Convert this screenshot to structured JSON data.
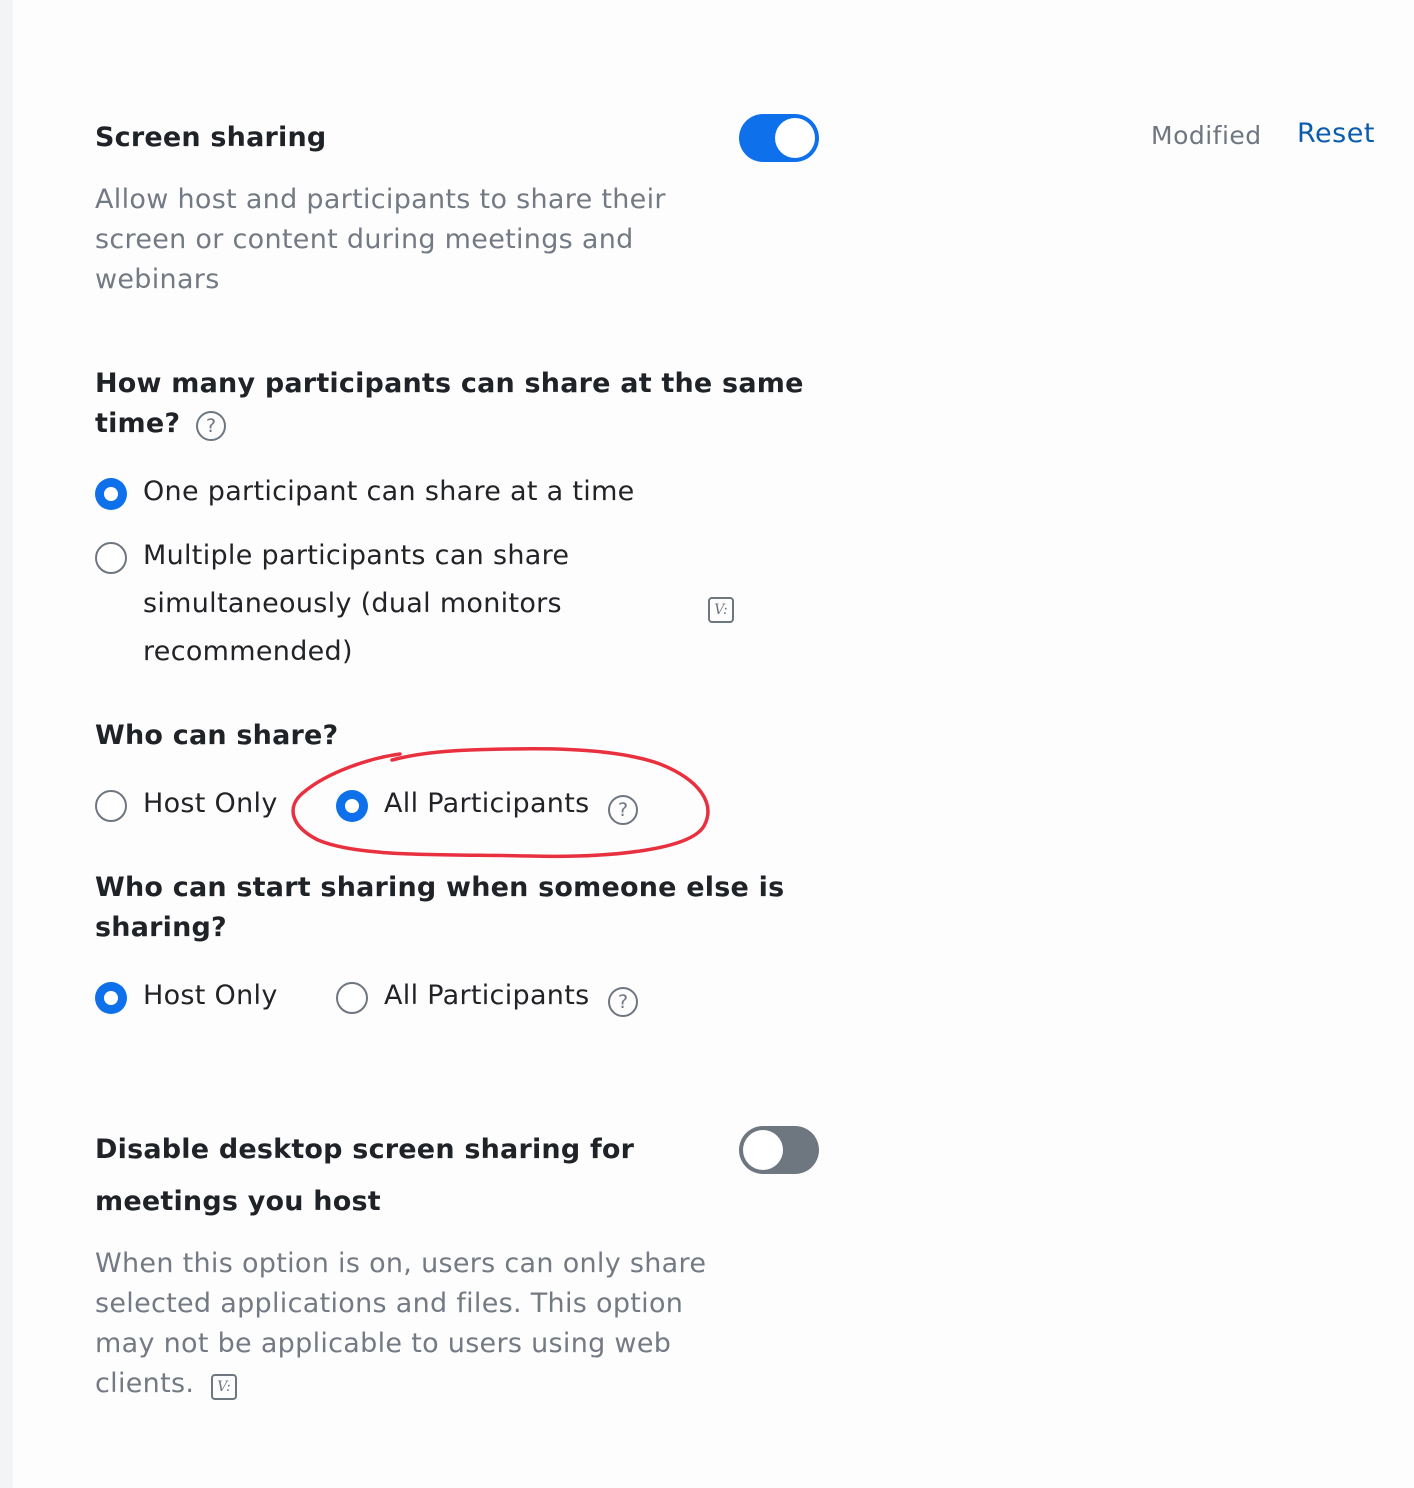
{
  "screen_sharing": {
    "title": "Screen sharing",
    "description_lines": [
      "Allow host and participants to share their",
      "screen or content during meetings and",
      "webinars"
    ],
    "enabled": true,
    "status": "Modified",
    "reset_label": "Reset"
  },
  "concurrent_share": {
    "question_lines": [
      "How many participants can share at the same",
      "time?"
    ],
    "options": [
      {
        "lines": [
          "One participant can share at a time"
        ],
        "checked": true
      },
      {
        "lines": [
          "Multiple participants can share",
          "simultaneously (dual monitors",
          "recommended)"
        ],
        "checked": false
      }
    ]
  },
  "who_can_share": {
    "question": "Who can share?",
    "options": [
      {
        "label": "Host Only",
        "checked": false
      },
      {
        "label": "All Participants",
        "checked": true
      }
    ],
    "annotation_color": "#e8303f"
  },
  "who_can_start": {
    "question_lines": [
      "Who can start sharing when someone else is",
      "sharing?"
    ],
    "options": [
      {
        "label": "Host Only",
        "checked": true
      },
      {
        "label": "All Participants",
        "checked": false
      }
    ]
  },
  "disable_desktop": {
    "title_lines": [
      "Disable desktop screen sharing for",
      "meetings you host"
    ],
    "enabled": false,
    "description_lines": [
      "When this option is on, users can only share",
      "selected applications and files. This option",
      "may not be applicable to users using web",
      "clients."
    ]
  },
  "icons": {
    "help_glyph": "?",
    "version_glyph": "V:"
  },
  "colors": {
    "accent": "#0e71eb",
    "toggle_off": "#6e7680",
    "link": "#0b5cad",
    "annotation": "#e8303f"
  }
}
